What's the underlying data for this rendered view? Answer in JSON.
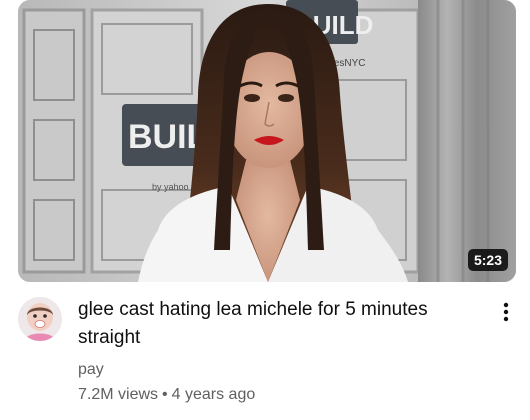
{
  "video": {
    "duration": "5:23",
    "title": "glee cast hating lea michele for 5 minutes straight",
    "channel": "pay",
    "views": "7.2M views",
    "separator": "•",
    "age": "4 years ago"
  },
  "thumbnail": {
    "sign_left_text": "BUIL",
    "sign_top_text": "BUILD",
    "sign_small_text": "SeriesNYC",
    "sign_sub_text": "by yahoo"
  },
  "icons": {
    "more": "vertical-dots-icon"
  },
  "colors": {
    "title": "#0f0f0f",
    "secondary": "#606060",
    "duration_bg": "#000000",
    "duration_text": "#ffffff"
  }
}
